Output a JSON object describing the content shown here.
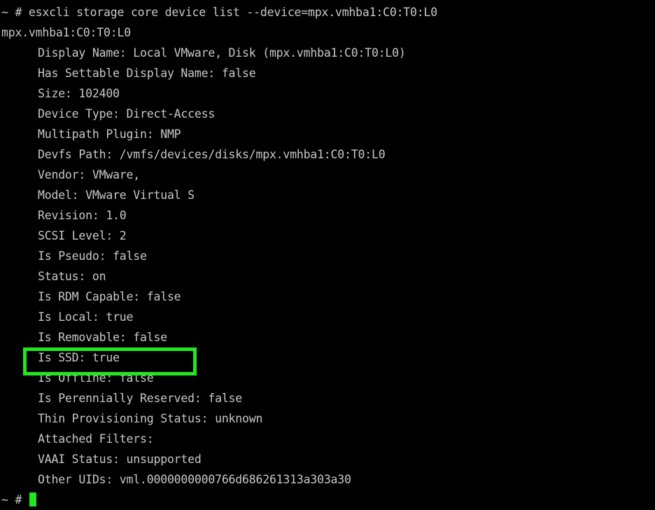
{
  "terminal": {
    "command_line": "~ # esxcli storage core device list --device=mpx.vmhba1:C0:T0:L0",
    "device_id": "mpx.vmhba1:C0:T0:L0",
    "properties": [
      "Display Name: Local VMware, Disk (mpx.vmhba1:C0:T0:L0)",
      "Has Settable Display Name: false",
      "Size: 102400",
      "Device Type: Direct-Access",
      "Multipath Plugin: NMP",
      "Devfs Path: /vmfs/devices/disks/mpx.vmhba1:C0:T0:L0",
      "Vendor: VMware,",
      "Model: VMware Virtual S",
      "Revision: 1.0",
      "SCSI Level: 2",
      "Is Pseudo: false",
      "Status: on",
      "Is RDM Capable: false",
      "Is Local: true",
      "Is Removable: false",
      "Is SSD: true",
      "Is Offline: false",
      "Is Perennially Reserved: false",
      "Thin Provisioning Status: unknown",
      "Attached Filters:",
      "VAAI Status: unsupported",
      "Other UIDs: vml.0000000000766d686261313a303a30"
    ],
    "prompt": "~ # ",
    "text_color": "#c8c8c8",
    "background_color": "#000000",
    "highlight_color": "#22e622",
    "highlighted_property": "Is SSD: true"
  }
}
